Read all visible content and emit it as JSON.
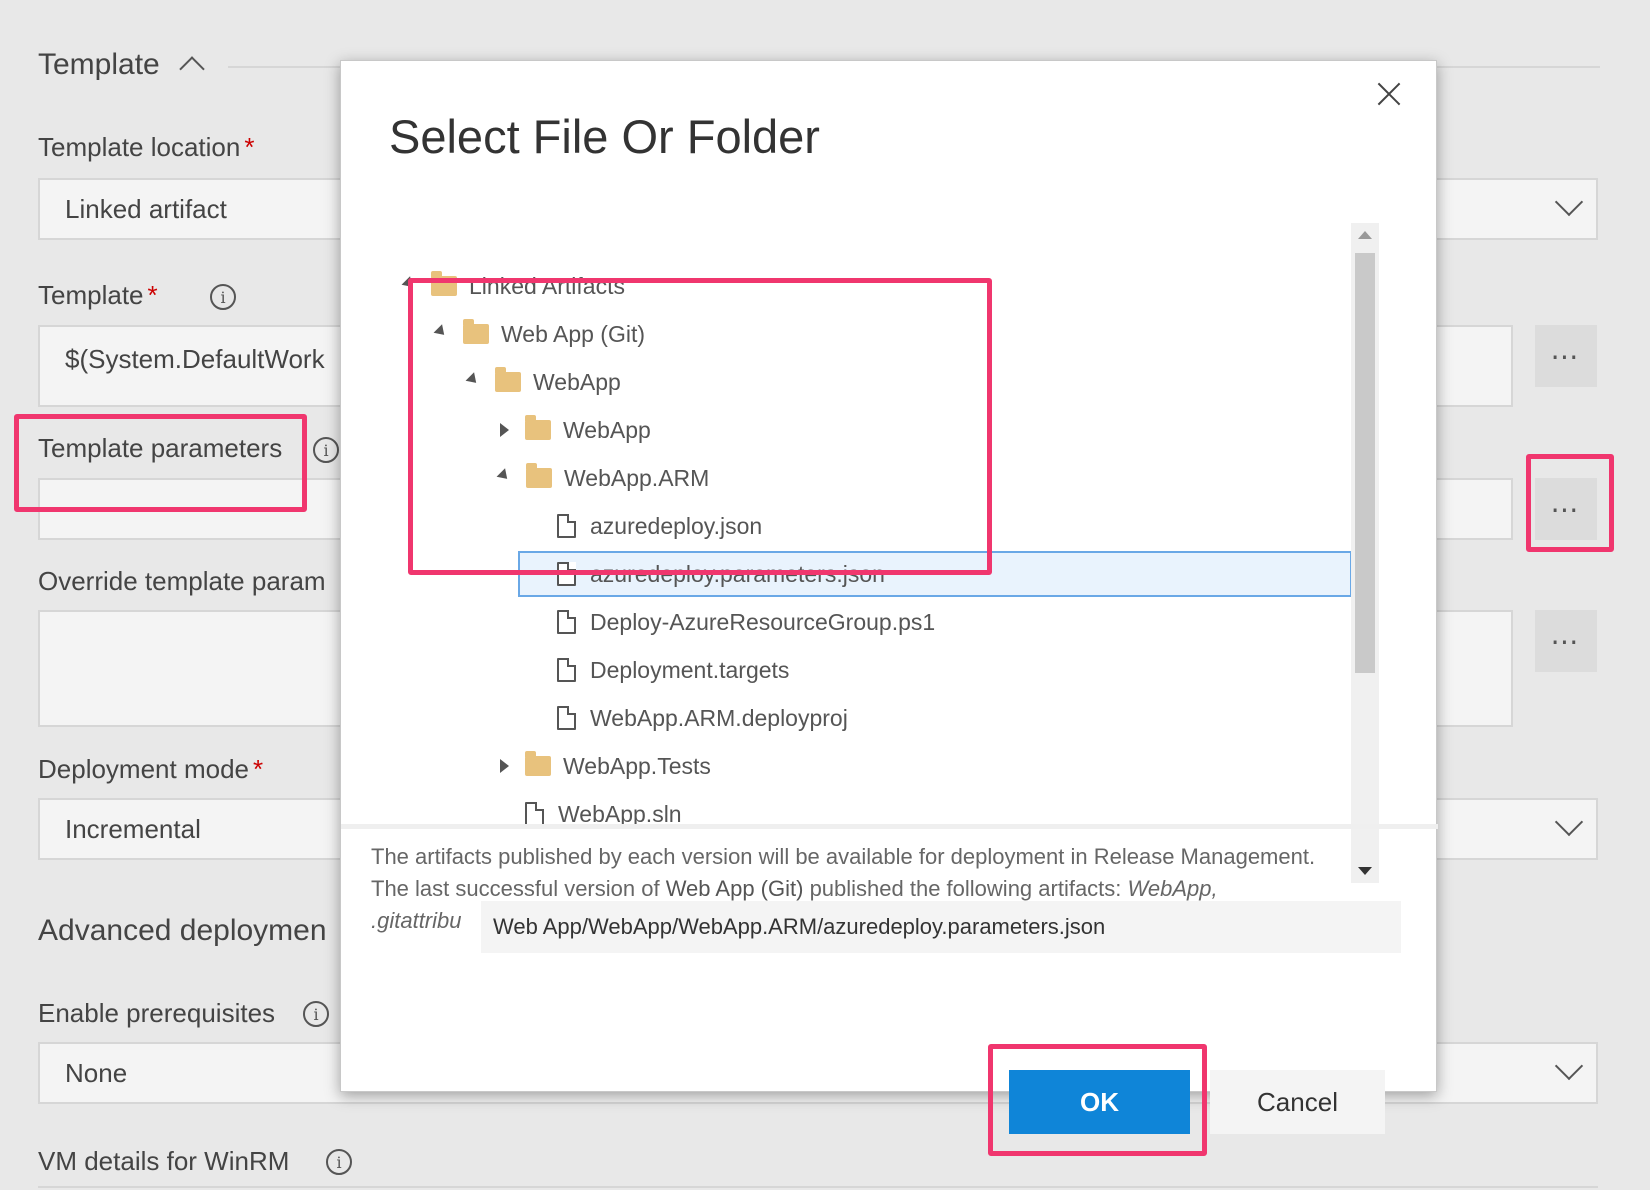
{
  "form": {
    "section_template": "Template",
    "template_location_label": "Template location",
    "template_location_value": "Linked artifact",
    "template_label": "Template",
    "template_value": "$(System.DefaultWork",
    "template_parameters_label": "Template parameters",
    "override_label": "Override template param",
    "deployment_mode_label": "Deployment mode",
    "deployment_mode_value": "Incremental",
    "advanced_section": "Advanced deploymen",
    "enable_prereq_label": "Enable prerequisites",
    "enable_prereq_value": "None",
    "vm_details_label": "VM details for WinRM",
    "required_marker": "*",
    "browse_label": "⋯",
    "info_glyph": "i"
  },
  "dialog": {
    "title": "Select File Or Folder",
    "tree": [
      {
        "label": "Linked Artifacts",
        "type": "folder",
        "state": "expanded",
        "depth": 0
      },
      {
        "label": "Web App (Git)",
        "type": "folder",
        "state": "expanded",
        "depth": 1
      },
      {
        "label": "WebApp",
        "type": "folder",
        "state": "expanded",
        "depth": 2
      },
      {
        "label": "WebApp",
        "type": "folder",
        "state": "collapsed",
        "depth": 3
      },
      {
        "label": "WebApp.ARM",
        "type": "folder",
        "state": "expanded",
        "depth": 3
      },
      {
        "label": "azuredeploy.json",
        "type": "file",
        "depth": 4
      },
      {
        "label": "azuredeploy.parameters.json",
        "type": "file",
        "depth": 4,
        "selected": true
      },
      {
        "label": "Deploy-AzureResourceGroup.ps1",
        "type": "file",
        "depth": 4
      },
      {
        "label": "Deployment.targets",
        "type": "file",
        "depth": 4
      },
      {
        "label": "WebApp.ARM.deployproj",
        "type": "file",
        "depth": 4
      },
      {
        "label": "WebApp.Tests",
        "type": "folder",
        "state": "collapsed",
        "depth": 3
      },
      {
        "label": "WebApp.sln",
        "type": "file",
        "depth": 3
      }
    ],
    "desc_line1": "The artifacts published by each version will be available for deployment in Release Management.",
    "desc_line2_prefix": "The last successful version of ",
    "desc_line2_name": "Web App (Git)",
    "desc_line2_mid": " published the following artifacts: ",
    "desc_line2_artifact": "WebApp,",
    "desc_line3": ".gitattribu",
    "selected_path": "Web App/WebApp/WebApp.ARM/azuredeploy.parameters.json",
    "ok_label": "OK",
    "cancel_label": "Cancel"
  },
  "colors": {
    "highlight": "#f0366e",
    "ok_button": "#0f85d8",
    "selected_row": "#e9f3fd",
    "folder": "#e8c27d"
  }
}
